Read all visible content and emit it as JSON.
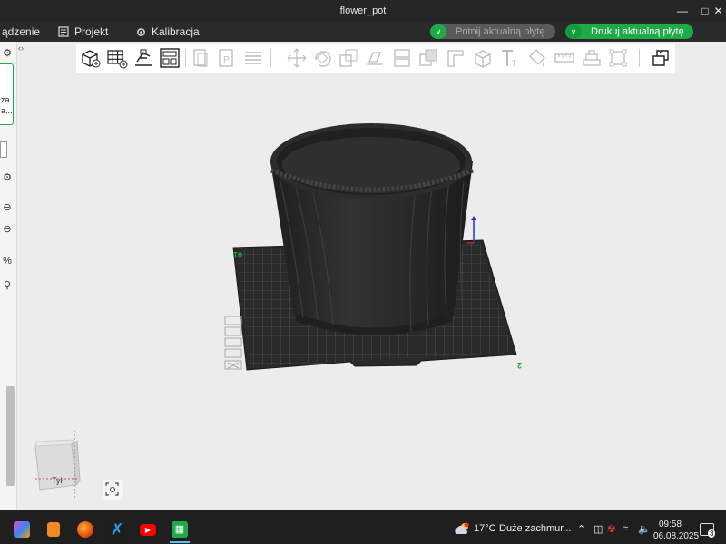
{
  "window": {
    "title": "flower_pot"
  },
  "menubar": {
    "items": [
      {
        "label": "ądzenie"
      },
      {
        "label": "Projekt"
      },
      {
        "label": "Kalibracja"
      }
    ],
    "slice_button": "Potnij aktualną płytę",
    "print_button": "Drukuj aktualną płytę"
  },
  "viewport": {
    "plate_label": "01",
    "corner_label": "2",
    "nav_cube_label": "Tył"
  },
  "taskbar": {
    "weather_temp": "17°C",
    "weather_desc": "Duże zachmur...",
    "time": "09:58",
    "date": "06.08.2025",
    "notifications": "3"
  },
  "colors": {
    "accent_green": "#1faa48",
    "titlebar": "#262626",
    "canvas": "#ececec",
    "pot": "#2b2b2b"
  }
}
